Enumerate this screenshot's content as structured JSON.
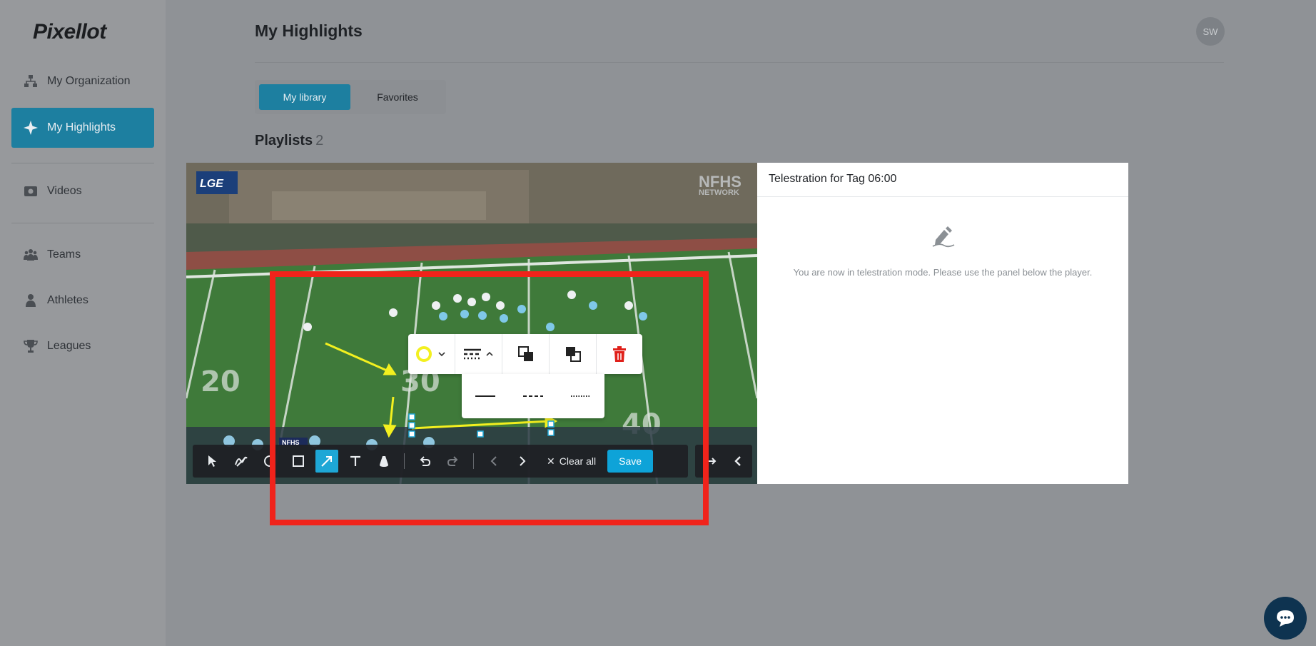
{
  "app": {
    "logo_text": "Pixellot",
    "user_initials": "SW"
  },
  "sidebar": {
    "items": [
      {
        "label": "My Organization",
        "icon": "org-chart-icon",
        "active": false
      },
      {
        "label": "My Highlights",
        "icon": "sparkle-icon",
        "active": true
      },
      {
        "label": "Videos",
        "icon": "video-icon",
        "active": false
      },
      {
        "label": "Teams",
        "icon": "teams-icon",
        "active": false
      },
      {
        "label": "Athletes",
        "icon": "athlete-icon",
        "active": false
      },
      {
        "label": "Leagues",
        "icon": "trophy-icon",
        "active": false
      }
    ]
  },
  "header": {
    "title": "My Highlights"
  },
  "tabs": [
    {
      "label": "My library",
      "active": true
    },
    {
      "label": "Favorites",
      "active": false
    }
  ],
  "playlists": {
    "label": "Playlists",
    "count": "2"
  },
  "video": {
    "overlay_logo_left": "LGE",
    "overlay_logo_right": "NFHS",
    "overlay_logo_right_sub": "NETWORK",
    "scoreboard_text": "NFHS"
  },
  "telestration": {
    "title": "Telestration for Tag 06:00",
    "message": "You are now in telestration mode. Please use the panel below the player.",
    "icon": "pen-sign-icon"
  },
  "toolbar": {
    "tools": [
      "cursor-icon",
      "freehand-icon",
      "circle-icon",
      "rectangle-icon",
      "arrow-icon",
      "text-icon",
      "spotlight-icon"
    ],
    "active_tool": "arrow-icon",
    "clear_label": "Clear all",
    "save_label": "Save"
  },
  "shape_toolbar": {
    "color": "#f3f01f",
    "line_styles": [
      "solid",
      "dashed",
      "dotted"
    ]
  },
  "colors": {
    "accent": "#1d7fa0",
    "save": "#0ea3d8",
    "highlight_box": "#f0231b",
    "delete": "#e0201a"
  }
}
